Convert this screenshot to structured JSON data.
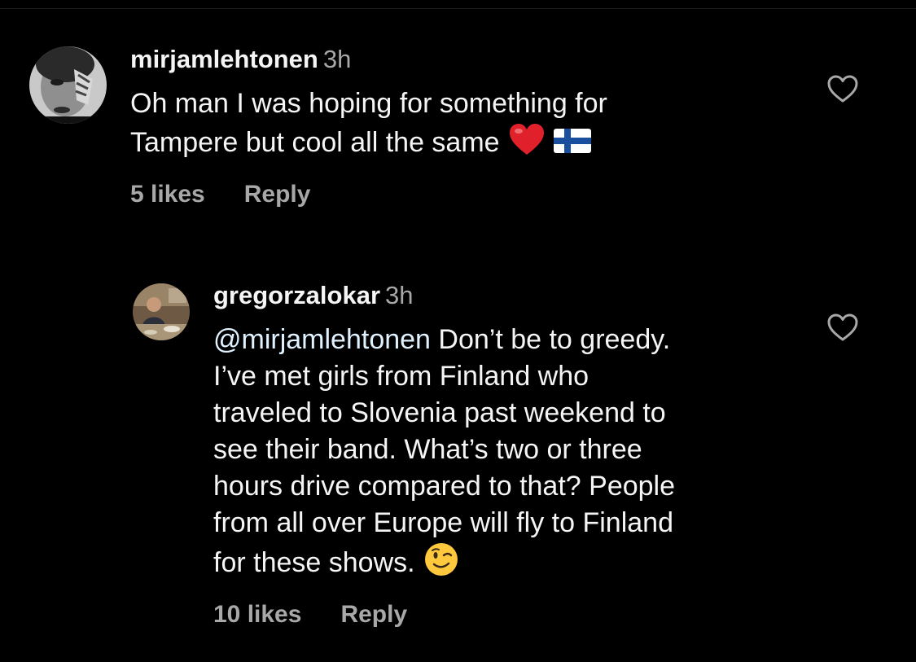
{
  "comments": [
    {
      "username": "mirjamlehtonen",
      "timestamp": "3h",
      "text_lines": [
        "Oh man I was hoping for something for",
        "Tampere but cool all the same"
      ],
      "emojis": [
        "red-heart-emoji",
        "finland-flag-emoji"
      ],
      "likes": "5 likes",
      "reply_label": "Reply"
    }
  ],
  "replies": [
    {
      "username": "gregorzalokar",
      "timestamp": "3h",
      "mention": "@mirjamlehtonen",
      "text_lines": [
        " Don’t be to greedy.",
        "I’ve met girls from Finland who",
        "traveled to Slovenia past weekend to",
        "see their band. What’s two or three",
        "hours drive compared to that? People",
        "from all over Europe will fly to Finland",
        "for these shows."
      ],
      "emojis": [
        "winking-face-emoji"
      ],
      "likes": "10 likes",
      "reply_label": "Reply"
    }
  ],
  "colors": {
    "background": "#000000",
    "primary_text": "#f5f5f5",
    "secondary_text": "#a8a8a8",
    "mention": "#e0f1ff",
    "heart_emoji": "#e0202a",
    "wink_emoji": "#ffc83d"
  },
  "icons": {
    "like": "heart-outline-icon"
  }
}
